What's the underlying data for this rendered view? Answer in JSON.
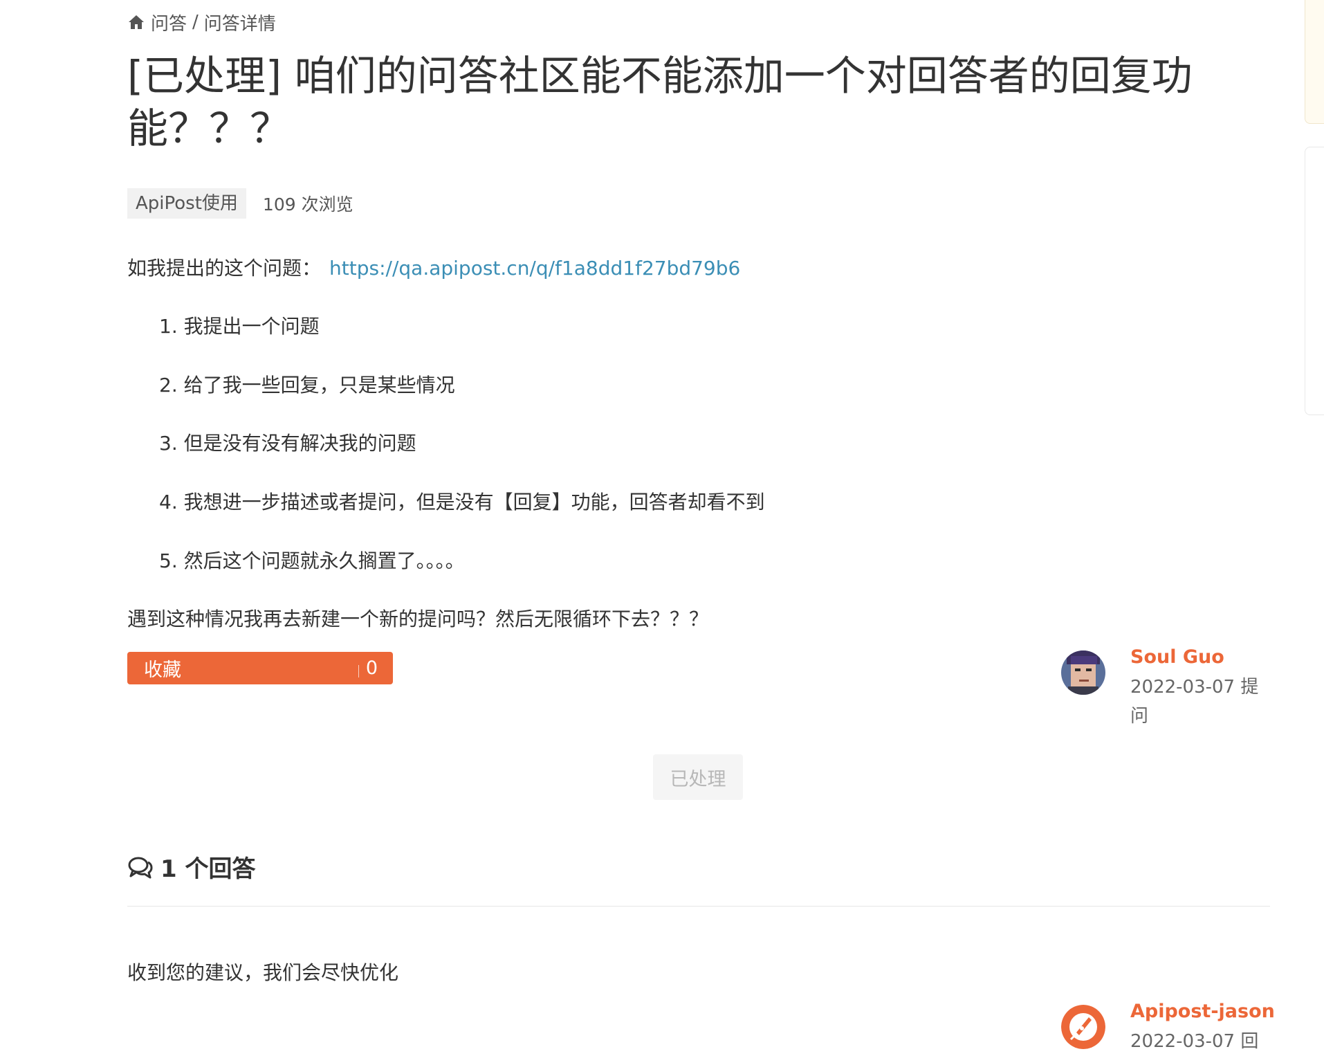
{
  "breadcrumb": {
    "home": "问答",
    "separator": "/",
    "current": "问答详情"
  },
  "question": {
    "title": "[已处理] 咱们的问答社区能不能添加一个对回答者的回复功能？？？",
    "tag": "ApiPost使用",
    "views": "109 次浏览",
    "intro": "如我提出的这个问题：",
    "link": "https://qa.apipost.cn/q/f1a8dd1f27bd79b6",
    "steps": [
      "1. 我提出一个问题",
      "2. 给了我一些回复，只是某些情况",
      "3. 但是没有没有解决我的问题",
      "4. 我想进一步描述或者提问，但是没有【回复】功能，回答者却看不到",
      "5. 然后这个问题就永久搁置了。。。。"
    ],
    "closing": "遇到这种情况我再去新建一个新的提问吗？然后无限循环下去？？？",
    "favorite_label": "收藏",
    "favorite_count": "0",
    "author": {
      "name": "Soul Guo",
      "date": "2022-03-07 提问"
    },
    "status_button": "已处理"
  },
  "answers": {
    "header": "1 个回答",
    "items": [
      {
        "text": "收到您的建议，我们会尽快优化",
        "author": "Apipost-jason",
        "date": "2022-03-07 回"
      }
    ]
  },
  "colors": {
    "accent": "#ec6738",
    "link": "#3b8eb5",
    "text": "#333333"
  },
  "icons": {
    "breadcrumb": "home-icon",
    "answers": "comments-icon"
  }
}
